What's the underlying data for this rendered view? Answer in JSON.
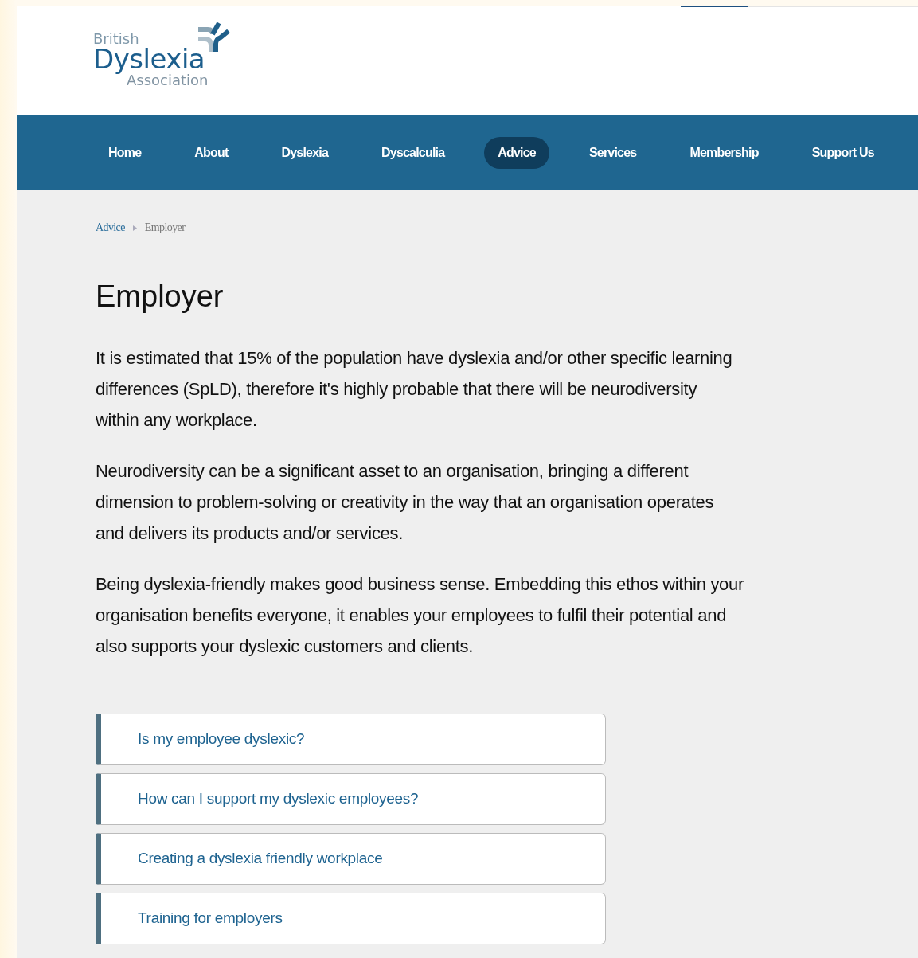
{
  "logo": {
    "line_1": "British",
    "line_2": "Dyslexia",
    "line_3": "Association"
  },
  "nav": [
    {
      "label": "Home",
      "selected": false
    },
    {
      "label": "About",
      "selected": false
    },
    {
      "label": "Dyslexia",
      "selected": false
    },
    {
      "label": "Dyscalculia",
      "selected": false
    },
    {
      "label": "Advice",
      "selected": true
    },
    {
      "label": "Services",
      "selected": false
    },
    {
      "label": "Membership",
      "selected": false
    },
    {
      "label": "Support Us",
      "selected": false
    }
  ],
  "breadcrumb": [
    "Advice",
    "Employer"
  ],
  "title": "Employer",
  "paragraphs": [
    "It is estimated that 15% of the population have dyslexia and/or other specific learning differences (SpLD), therefore it's highly probable that there will be neurodiversity within any workplace.",
    "Neurodiversity can be a significant asset to an organisation, bringing a different dimension to problem-solving or creativity in the way that an organisation operates and delivers its products and/or services.",
    "Being dyslexia-friendly makes good business sense. Embedding this ethos within your organisation benefits everyone, it enables your employees to fulfil their potential and also supports your dyslexic customers and clients."
  ],
  "accordion": [
    {
      "label": "Is my employee dyslexic?"
    },
    {
      "label": "How can I support my dyslexic employees?"
    },
    {
      "label": "Creating a dyslexia friendly workplace"
    },
    {
      "label": "Training for employers"
    }
  ]
}
